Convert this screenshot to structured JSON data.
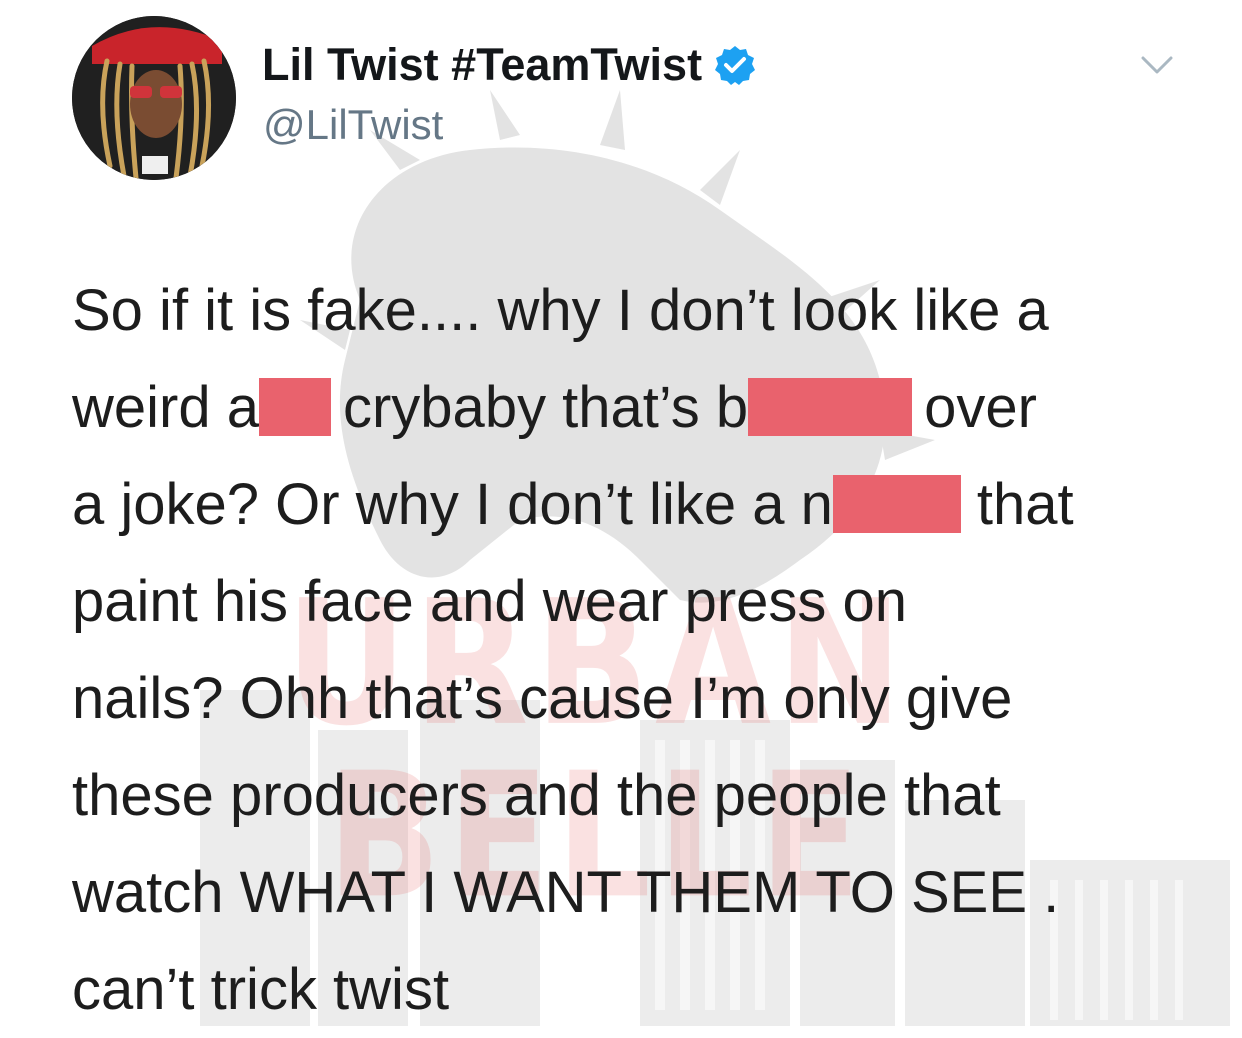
{
  "watermark": {
    "text": "URBAN BELLE"
  },
  "header": {
    "display_name": "Lil Twist #TeamTwist",
    "handle": "@LilTwist",
    "avatar_icon": "profile-avatar",
    "verified_icon": "verified-badge-icon",
    "menu_icon": "chevron-down-icon",
    "accent_color": "#1da1f2"
  },
  "tweet": {
    "line1": "So if it is fake.... why I don’t look like a",
    "line2_a": "weird a",
    "line2_b": "crybaby that’s b",
    "line2_c": "over",
    "line3_a": "a joke? Or why I don’t like a n",
    "line3_b": "that",
    "line4": "paint his face and wear press on",
    "line5": "nails? Ohh that’s cause I’m only give",
    "line6": "these producers and the people that",
    "line7": "watch WHAT I WANT THEM TO SEE .",
    "line8": "can’t trick twist",
    "redaction_color": "#e9626d"
  }
}
